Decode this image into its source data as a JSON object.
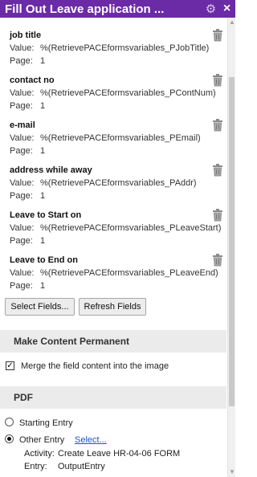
{
  "window": {
    "title": "Fill Out Leave application ..."
  },
  "fields": [
    {
      "name": "job title",
      "value_label": "Value:",
      "value": "%(RetrievePACEformsvariables_PJobTitle)",
      "page_label": "Page:",
      "page": "1"
    },
    {
      "name": "contact no",
      "value_label": "Value:",
      "value": "%(RetrievePACEformsvariables_PContNum)",
      "page_label": "Page:",
      "page": "1"
    },
    {
      "name": "e-mail",
      "value_label": "Value:",
      "value": "%(RetrievePACEformsvariables_PEmail)",
      "page_label": "Page:",
      "page": "1"
    },
    {
      "name": "address while away",
      "value_label": "Value:",
      "value": "%(RetrievePACEformsvariables_PAddr)",
      "page_label": "Page:",
      "page": "1"
    },
    {
      "name": "Leave to Start on",
      "value_label": "Value:",
      "value": "%(RetrievePACEformsvariables_PLeaveStart)",
      "page_label": "Page:",
      "page": "1"
    },
    {
      "name": "Leave to End on",
      "value_label": "Value:",
      "value": "%(RetrievePACEformsvariables_PLeaveEnd)",
      "page_label": "Page:",
      "page": "1"
    }
  ],
  "buttons": {
    "select_fields": "Select Fields...",
    "refresh_fields": "Refresh Fields"
  },
  "make_permanent": {
    "header": "Make Content Permanent",
    "checkbox_label": "Merge the field content into the image",
    "checked": true
  },
  "pdf": {
    "header": "PDF",
    "starting_entry_label": "Starting Entry",
    "other_entry_label": "Other Entry",
    "select_link": "Select...",
    "selected_option": "Other Entry",
    "activity_label": "Activity:",
    "activity_value": "Create Leave HR-04-06 FORM",
    "entry_label": "Entry:",
    "entry_value": "OutputEntry"
  },
  "colors": {
    "titlebar": "#6b2aa6",
    "section_bg": "#ebebeb",
    "link": "#1a52c9"
  },
  "icons": {
    "settings": "gear-icon",
    "close": "close-icon",
    "delete": "trash-icon"
  }
}
